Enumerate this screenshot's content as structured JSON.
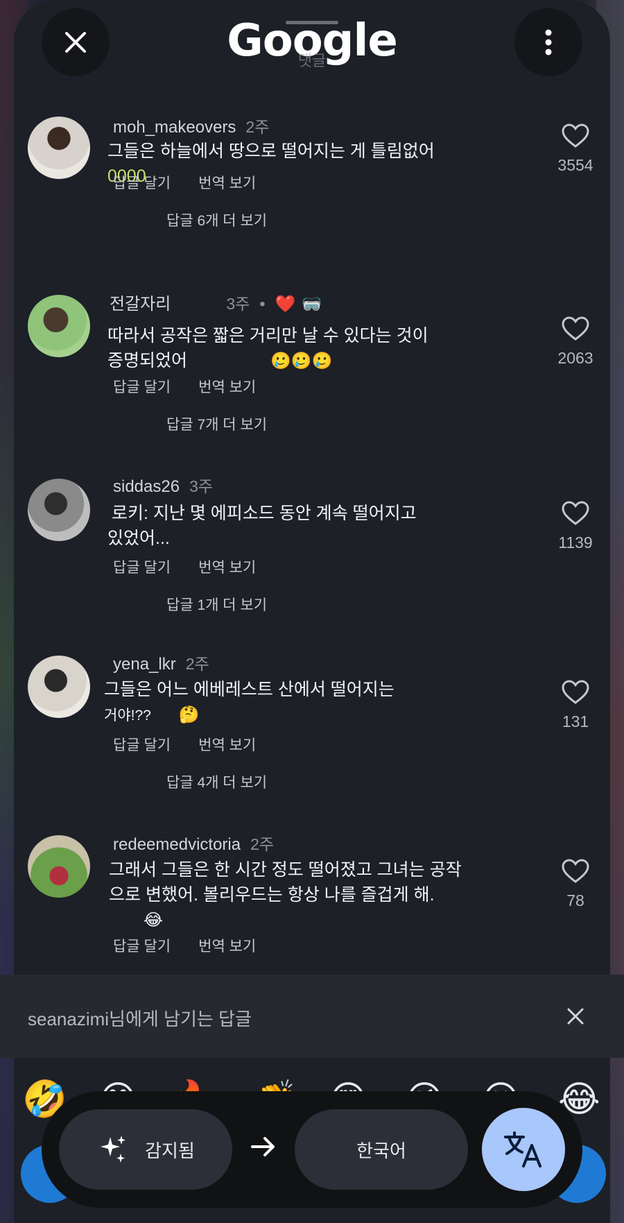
{
  "header": {
    "logo": "Google",
    "ghost_title": "댓글"
  },
  "comments": [
    {
      "username": "moh_makeovers",
      "time": "2주",
      "text": "그들은 하늘에서 땅으로 떨어지는 게 틀림없어",
      "text2": "0000",
      "reply_label": "답글 달기",
      "translate_label": "번역 보기",
      "more_replies": "답글 6개 더 보기",
      "likes": "3554",
      "avatar_colors": [
        "#c9b8a8",
        "#3a2a22"
      ]
    },
    {
      "username": "전갈자리",
      "time": "3주",
      "badges": [
        "❤️",
        "🥽"
      ],
      "text": "따라서 공작은 짧은 거리만 날 수 있다는 것이",
      "text2": "증명되었어",
      "emojis": "🥲🥲🥲",
      "reply_label": "답글 달기",
      "translate_label": "번역 보기",
      "more_replies": "답글 7개 더 보기",
      "likes": "2063",
      "avatar_colors": [
        "#7fbf6a",
        "#4a3a2e"
      ]
    },
    {
      "username": "siddas26",
      "time": "3주",
      "text": "로키: 지난 몇 에피소드 동안 계속 떨어지고",
      "text2": "있었어...",
      "reply_label": "답글 달기",
      "translate_label": "번역 보기",
      "more_replies": "답글 1개 더 보기",
      "likes": "1139",
      "avatar_colors": [
        "#9a9a9a",
        "#2e2e2e"
      ]
    },
    {
      "username": "yena_lkr",
      "time": "2주",
      "text": "그들은 어느 에베레스트 산에서 떨어지는",
      "text2": "거야!??",
      "emojis": "🤔",
      "reply_label": "답글 달기",
      "translate_label": "번역 보기",
      "more_replies": "답글 4개 더 보기",
      "likes": "131",
      "avatar_colors": [
        "#e8e6e0",
        "#2a2a2a"
      ]
    },
    {
      "username": "redeemedvictoria",
      "time": "2주",
      "text": "그래서 그들은 한 시간 정도 떨어졌고 그녀는 공작",
      "text2": "으로 변했어. 볼리우드는 항상 나를 즐겁게 해.",
      "emojis": "😂",
      "reply_label": "답글 달기",
      "translate_label": "번역 보기",
      "likes": "78",
      "avatar_colors": [
        "#6aa04a",
        "#b03040"
      ]
    }
  ],
  "reply_bar": {
    "hint": "seanazimi님에게 남기는 답글"
  },
  "emoji_bar": [
    "🤣",
    "😊",
    "🔥",
    "👏",
    "😍",
    "😘",
    "😮",
    "😂"
  ],
  "translate_bar": {
    "detected_label": "감지됨",
    "target_label": "한국어",
    "accent": "#a8c7fa"
  }
}
